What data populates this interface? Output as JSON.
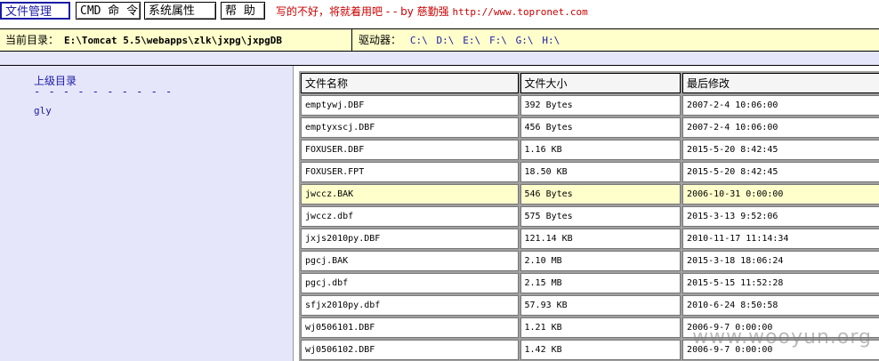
{
  "menu": {
    "items": [
      "文件管理",
      "CMD 命 令",
      "系统属性",
      "帮 助"
    ],
    "slogan_text": "写的不好，将就着用吧 - - by 慈勤强",
    "slogan_url": "http://www.topronet.com"
  },
  "pathbar": {
    "label": "当前目录：",
    "path": "E:\\Tomcat 5.5\\webapps\\zlk\\jxpg\\jxpgDB",
    "drives_label": "驱动器：",
    "drives": [
      "C:\\",
      "D:\\",
      "E:\\",
      "F:\\",
      "G:\\",
      "H:\\"
    ]
  },
  "sidebar": {
    "up_label": "上级目录",
    "dashes": "- - - - - - - - - -",
    "folders": [
      "gly"
    ]
  },
  "table": {
    "headers": [
      "文件名称",
      "文件大小",
      "最后修改"
    ],
    "rows": [
      [
        "emptywj.DBF",
        "392 Bytes",
        "2007-2-4 10:06:00"
      ],
      [
        "emptyxscj.DBF",
        "456 Bytes",
        "2007-2-4 10:06:00"
      ],
      [
        "FOXUSER.DBF",
        "1.16 KB",
        "2015-5-20 8:42:45"
      ],
      [
        "FOXUSER.FPT",
        "18.50 KB",
        "2015-5-20 8:42:45"
      ],
      [
        "jwccz.BAK",
        "546 Bytes",
        "2006-10-31 0:00:00"
      ],
      [
        "jwccz.dbf",
        "575 Bytes",
        "2015-3-13 9:52:06"
      ],
      [
        "jxjs2010py.DBF",
        "121.14 KB",
        "2010-11-17 11:14:34"
      ],
      [
        "pgcj.BAK",
        "2.10 MB",
        "2015-3-18 18:06:24"
      ],
      [
        "pgcj.dbf",
        "2.15 MB",
        "2015-5-15 11:52:28"
      ],
      [
        "sfjx2010py.dbf",
        "57.93 KB",
        "2010-6-24 8:50:58"
      ],
      [
        "wj0506101.DBF",
        "1.21 KB",
        "2006-9-7 0:00:00"
      ],
      [
        "wj0506102.DBF",
        "1.42 KB",
        "2006-9-7 0:00:00"
      ]
    ],
    "highlighted_row": 4
  },
  "watermark": "www.wooyun.org",
  "colors": {
    "path_bg": "#ffffcc",
    "sidebar_bg": "#e6e6fa",
    "link": "#1a1aa6",
    "slogan": "#cc0000"
  }
}
